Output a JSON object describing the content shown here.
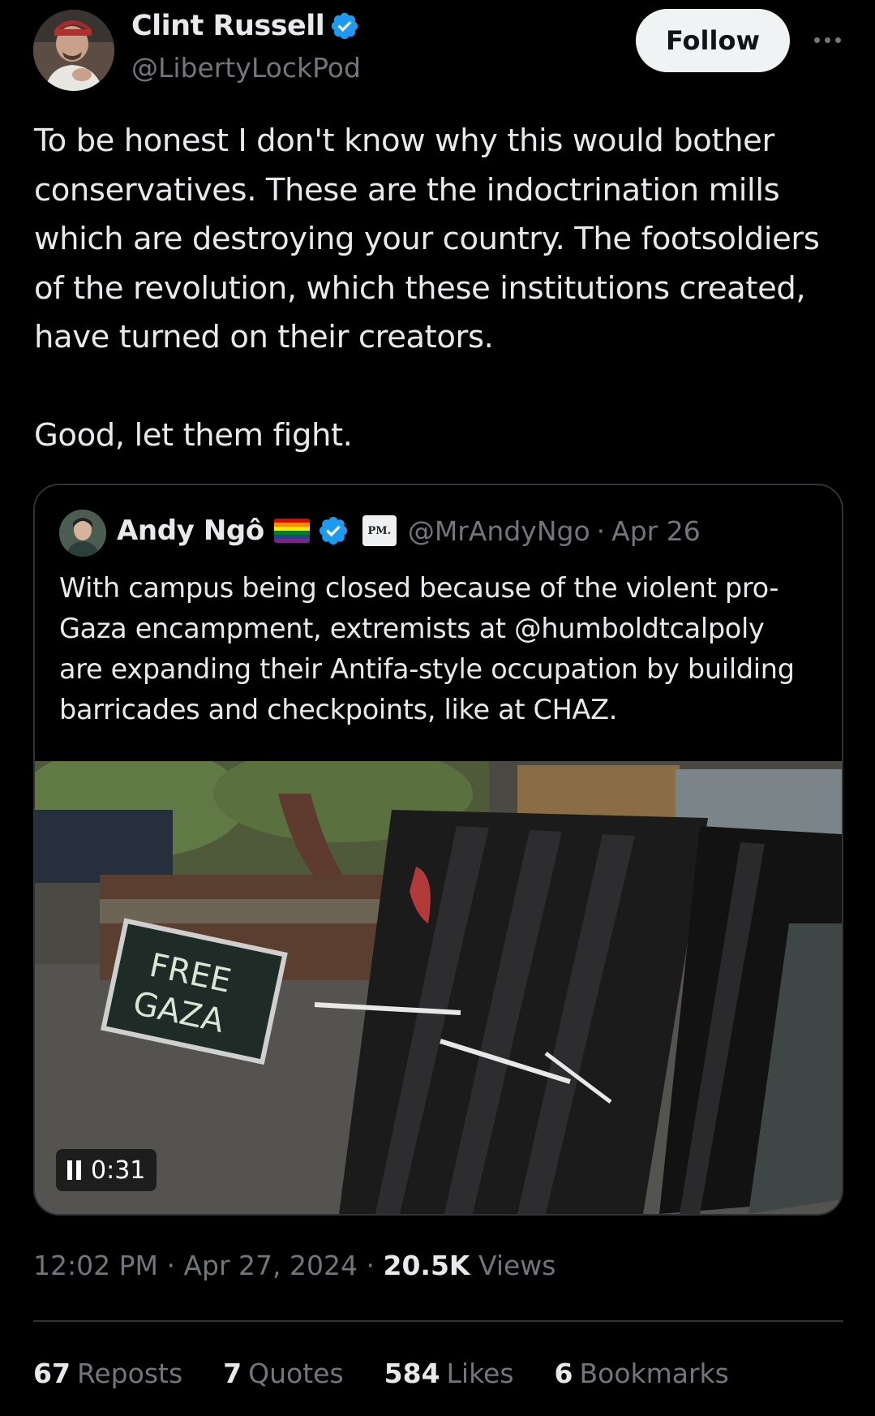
{
  "author": {
    "display_name": "Clint Russell",
    "handle": "@LibertyLockPod",
    "verified": true,
    "avatar_icon": "person-photo-avatar"
  },
  "actions": {
    "follow_label": "Follow",
    "more_icon": "more-horizontal-icon"
  },
  "tweet": {
    "lines": [
      "To be honest I don't know why this would bother",
      "conservatives. These are the indoctrination mills",
      "which are destroying your country. The footsoldiers",
      "of the revolution, which these institutions created,",
      "have turned on their creators."
    ],
    "closing": "Good, let them fight."
  },
  "quoted": {
    "display_name": "Andy Ngô",
    "badge_label": "PM.",
    "handle": "@MrAndyNgo",
    "separator": "·",
    "date": "Apr 26",
    "lines": [
      "With campus being closed because of the violent pro-",
      "Gaza encampment, extremists at @humboldtcalpoly",
      "are expanding their Antifa-style occupation by building",
      "barricades and checkpoints, like at CHAZ."
    ],
    "media": {
      "sign_text_line1": "FREE",
      "sign_text_line2": "GAZA",
      "video_time": "0:31"
    }
  },
  "meta": {
    "time": "12:02 PM",
    "sep1": "·",
    "date": "Apr 27, 2024",
    "sep2": "·",
    "views_count": "20.5K",
    "views_label": "Views"
  },
  "stats": [
    {
      "count": "67",
      "label": "Reposts"
    },
    {
      "count": "7",
      "label": "Quotes"
    },
    {
      "count": "584",
      "label": "Likes"
    },
    {
      "count": "6",
      "label": "Bookmarks"
    }
  ],
  "colors": {
    "background": "#000000",
    "text": "#e7e9ea",
    "muted": "#71767b",
    "verified_blue": "#1d9bf0",
    "border": "#2f3336"
  }
}
